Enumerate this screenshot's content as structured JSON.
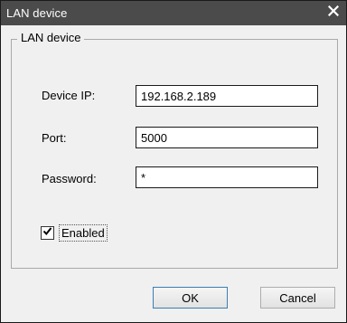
{
  "window": {
    "title": "LAN device",
    "close_icon": "close-icon"
  },
  "group": {
    "legend": "LAN device"
  },
  "fields": {
    "device_ip": {
      "label": "Device IP:",
      "value": "192.168.2.189"
    },
    "port": {
      "label": "Port:",
      "value": "5000"
    },
    "password": {
      "label": "Password:",
      "value": "*"
    }
  },
  "enabled": {
    "label": "Enabled",
    "checked": true,
    "check_icon": "checkmark-icon"
  },
  "buttons": {
    "ok": "OK",
    "cancel": "Cancel"
  },
  "colors": {
    "titlebar": "#4b4b4b",
    "dialog_bg": "#f0f0f0",
    "default_button_border": "#3c7fb1"
  }
}
